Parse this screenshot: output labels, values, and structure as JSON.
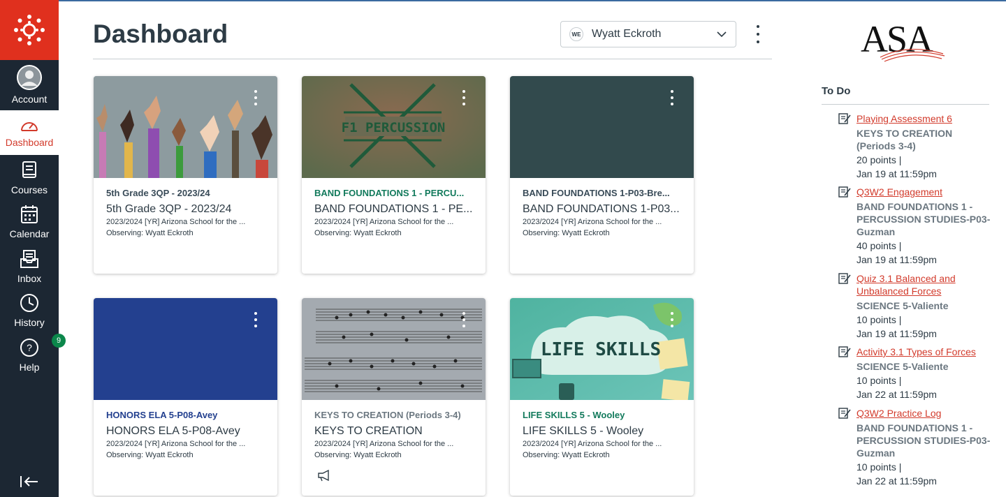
{
  "nav": {
    "items": [
      {
        "label": "Account",
        "icon": "avatar-icon"
      },
      {
        "label": "Dashboard",
        "icon": "dashboard-icon"
      },
      {
        "label": "Courses",
        "icon": "courses-icon"
      },
      {
        "label": "Calendar",
        "icon": "calendar-icon"
      },
      {
        "label": "Inbox",
        "icon": "inbox-icon"
      },
      {
        "label": "History",
        "icon": "history-icon"
      },
      {
        "label": "Help",
        "icon": "help-icon"
      }
    ],
    "help_badge": "9"
  },
  "header": {
    "title": "Dashboard",
    "observer_initials": "WE",
    "observer_name": "Wyatt Eckroth"
  },
  "cards": [
    {
      "code": "5th Grade 3QP - 2023/24",
      "name": "5th Grade 3QP - 2023/24",
      "term": "2023/2024 [YR] Arizona School for the ...",
      "observing": "Observing: Wyatt Eckroth",
      "color": "#394B58"
    },
    {
      "code": "BAND FOUNDATIONS 1 - PERCU...",
      "name": "BAND FOUNDATIONS 1 - PE...",
      "term": "2023/2024 [YR] Arizona School for the ...",
      "observing": "Observing: Wyatt Eckroth",
      "color": "#127A1B",
      "hero_text": "F1 PERCUSSION"
    },
    {
      "code": "BAND FOUNDATIONS 1-P03-Bre...",
      "name": "BAND FOUNDATIONS 1-P03...",
      "term": "2023/2024 [YR] Arizona School for the ...",
      "observing": "Observing: Wyatt Eckroth",
      "color": "#BF2020"
    },
    {
      "code": "HONORS ELA 5-P08-Avey",
      "name": "HONORS ELA 5-P08-Avey",
      "term": "2023/2024 [YR] Arizona School for the ...",
      "observing": "Observing: Wyatt Eckroth",
      "color": "#23408F"
    },
    {
      "code": "KEYS TO CREATION (Periods 3-4)",
      "name": "KEYS TO CREATION",
      "term": "2023/2024 [YR] Arizona School for the ...",
      "observing": "Observing: Wyatt Eckroth",
      "color": "#6B7780"
    },
    {
      "code": "LIFE SKILLS 5 - Wooley",
      "name": "LIFE SKILLS 5 - Wooley",
      "term": "2023/2024 [YR] Arizona School for the ...",
      "observing": "Observing: Wyatt Eckroth",
      "color": "#127A5C",
      "hero_text": "LIFE SKILLS"
    }
  ],
  "todo": {
    "title": "To Do",
    "items": [
      {
        "link": "Playing Assessment 6",
        "course": "KEYS TO CREATION (Periods 3-4)",
        "points": "20 points  |",
        "due": "Jan 19 at 11:59pm"
      },
      {
        "link": "Q3W2 Engagement",
        "course": "BAND FOUNDATIONS 1 - PERCUSSION STUDIES-P03-Guzman",
        "points": "40 points  |",
        "due": "Jan 19 at 11:59pm"
      },
      {
        "link": "Quiz 3.1  Balanced and Unbalanced Forces",
        "course": "SCIENCE 5-Valiente",
        "points": "10 points  |",
        "due": "Jan 19 at 11:59pm"
      },
      {
        "link": "Activity 3.1  Types of Forces",
        "course": "SCIENCE 5-Valiente",
        "points": "10 points  |",
        "due": "Jan 22 at 11:59pm"
      },
      {
        "link": "Q3W2 Practice Log",
        "course": "BAND FOUNDATIONS 1 - PERCUSSION STUDIES-P03-Guzman",
        "points": "10 points  |",
        "due": "Jan 22 at 11:59pm"
      }
    ]
  },
  "brand": {
    "logo_text": "ASA",
    "accent": "#E0301E"
  }
}
